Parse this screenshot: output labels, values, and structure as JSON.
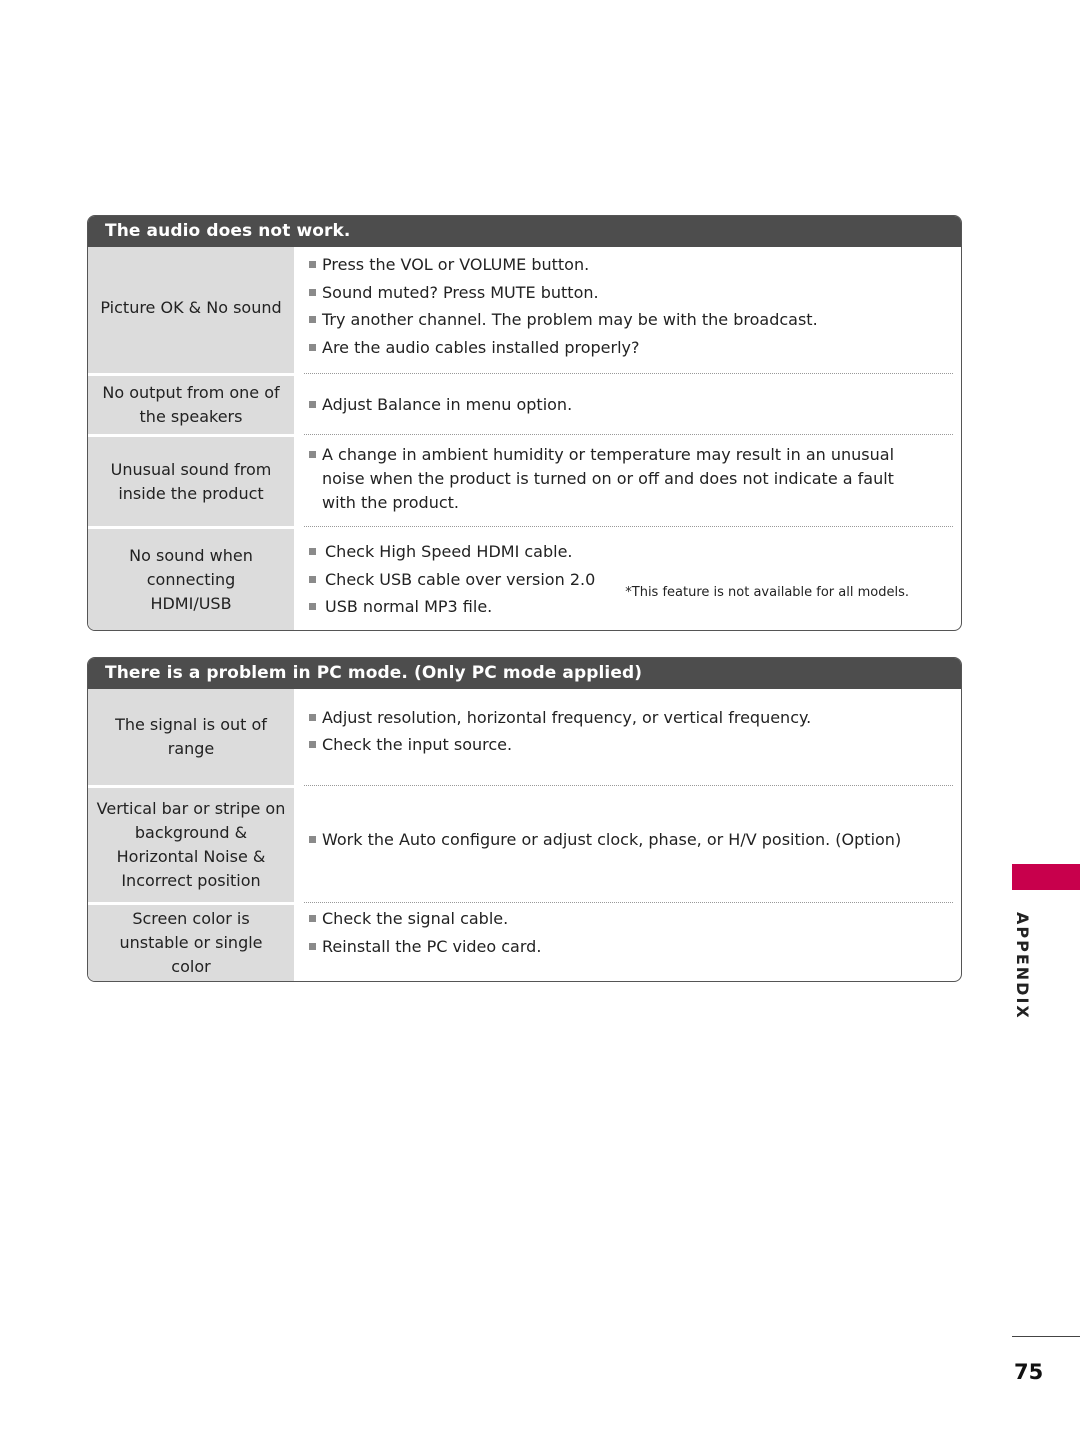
{
  "sections": [
    {
      "title": "The audio does not work.",
      "rows": [
        {
          "cause": "Picture OK & No sound",
          "solutions": [
            "Press the VOL or VOLUME button.",
            "Sound muted? Press MUTE button.",
            "Try another channel. The problem may be with the broadcast.",
            "Are the audio cables installed properly?"
          ]
        },
        {
          "cause": "No output from one of the speakers",
          "solutions": [
            "Adjust Balance in menu option."
          ]
        },
        {
          "cause": "Unusual sound from inside the product",
          "solutions": [
            "A change in ambient humidity or temperature may result in an unusual noise when the product is turned on or off and does not indicate a fault with the product."
          ]
        },
        {
          "cause": "No sound when connecting HDMI/USB",
          "solutions": [
            "Check High Speed HDMI cable.",
            "Check USB cable over version 2.0",
            "USB normal MP3 file."
          ],
          "footnote": "*This feature is not available for all models."
        }
      ]
    },
    {
      "title": "There is a problem in PC mode. (Only PC mode applied)",
      "rows": [
        {
          "cause": "The signal is out of range",
          "solutions": [
            "Adjust resolution, horizontal frequency, or vertical frequency.",
            "Check the input source."
          ]
        },
        {
          "cause": "Vertical bar or stripe on background & Horizontal Noise & Incorrect position",
          "solutions": [
            "Work the Auto configure or adjust clock, phase, or H/V position. (Option)"
          ]
        },
        {
          "cause": "Screen color is unstable or single color",
          "solutions": [
            "Check the signal cable.",
            "Reinstall the PC video card."
          ]
        }
      ]
    }
  ],
  "side_tab": {
    "label": "APPENDIX",
    "color": "#c8004c"
  },
  "page_number": "75"
}
